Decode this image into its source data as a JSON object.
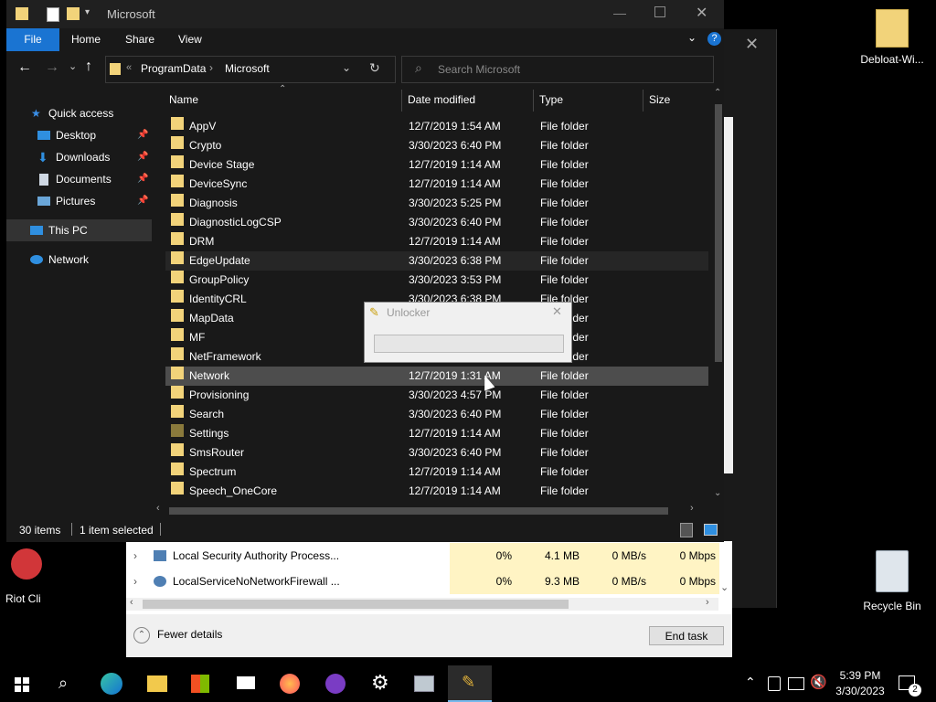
{
  "desktop": {
    "icons": [
      {
        "label": "Debloat-Wi..."
      },
      {
        "label": "Recycle Bin"
      },
      {
        "label": "Riot Cli"
      }
    ]
  },
  "task_manager": {
    "rows": [
      {
        "name": "Local Security Authority Process...",
        "cpu": "0%",
        "memory": "4.1 MB",
        "disk": "0 MB/s",
        "network": "0 Mbps"
      },
      {
        "name": "LocalServiceNoNetworkFirewall ...",
        "cpu": "0%",
        "memory": "9.3 MB",
        "disk": "0 MB/s",
        "network": "0 Mbps"
      }
    ],
    "fewer_details": "Fewer details",
    "end_task": "End task"
  },
  "explorer": {
    "title": "Microsoft",
    "ribbon_tabs": [
      "File",
      "Home",
      "Share",
      "View"
    ],
    "breadcrumb": {
      "overflow": "«",
      "parts": [
        "ProgramData",
        "Microsoft"
      ]
    },
    "search_placeholder": "Search Microsoft",
    "nav": {
      "quick_access": "Quick access",
      "items": [
        "Desktop",
        "Downloads",
        "Documents",
        "Pictures"
      ],
      "this_pc": "This PC",
      "network": "Network"
    },
    "columns": [
      "Name",
      "Date modified",
      "Type",
      "Size"
    ],
    "files": [
      {
        "name": "AppV",
        "date": "12/7/2019 1:54 AM",
        "type": "File folder"
      },
      {
        "name": "Crypto",
        "date": "3/30/2023 6:40 PM",
        "type": "File folder"
      },
      {
        "name": "Device Stage",
        "date": "12/7/2019 1:14 AM",
        "type": "File folder"
      },
      {
        "name": "DeviceSync",
        "date": "12/7/2019 1:14 AM",
        "type": "File folder"
      },
      {
        "name": "Diagnosis",
        "date": "3/30/2023 5:25 PM",
        "type": "File folder"
      },
      {
        "name": "DiagnosticLogCSP",
        "date": "3/30/2023 6:40 PM",
        "type": "File folder"
      },
      {
        "name": "DRM",
        "date": "12/7/2019 1:14 AM",
        "type": "File folder"
      },
      {
        "name": "EdgeUpdate",
        "date": "3/30/2023 6:38 PM",
        "type": "File folder"
      },
      {
        "name": "GroupPolicy",
        "date": "3/30/2023 3:53 PM",
        "type": "File folder"
      },
      {
        "name": "IdentityCRL",
        "date": "3/30/2023 6:38 PM",
        "type": "File folder"
      },
      {
        "name": "MapData",
        "date": "",
        "type": "File folder"
      },
      {
        "name": "MF",
        "date": "",
        "type": "File folder"
      },
      {
        "name": "NetFramework",
        "date": "",
        "type": "File folder"
      },
      {
        "name": "Network",
        "date": "12/7/2019 1:31 AM",
        "type": "File folder"
      },
      {
        "name": "Provisioning",
        "date": "3/30/2023 4:57 PM",
        "type": "File folder"
      },
      {
        "name": "Search",
        "date": "3/30/2023 6:40 PM",
        "type": "File folder"
      },
      {
        "name": "Settings",
        "date": "12/7/2019 1:14 AM",
        "type": "File folder"
      },
      {
        "name": "SmsRouter",
        "date": "3/30/2023 6:40 PM",
        "type": "File folder"
      },
      {
        "name": "Spectrum",
        "date": "12/7/2019 1:14 AM",
        "type": "File folder"
      },
      {
        "name": "Speech_OneCore",
        "date": "12/7/2019 1:14 AM",
        "type": "File folder"
      }
    ],
    "status": {
      "count": "30 items",
      "selected": "1 item selected"
    }
  },
  "unlocker": {
    "title": "Unlocker"
  },
  "taskbar": {
    "time": "5:39 PM",
    "date": "3/30/2023",
    "notification_count": "2"
  }
}
